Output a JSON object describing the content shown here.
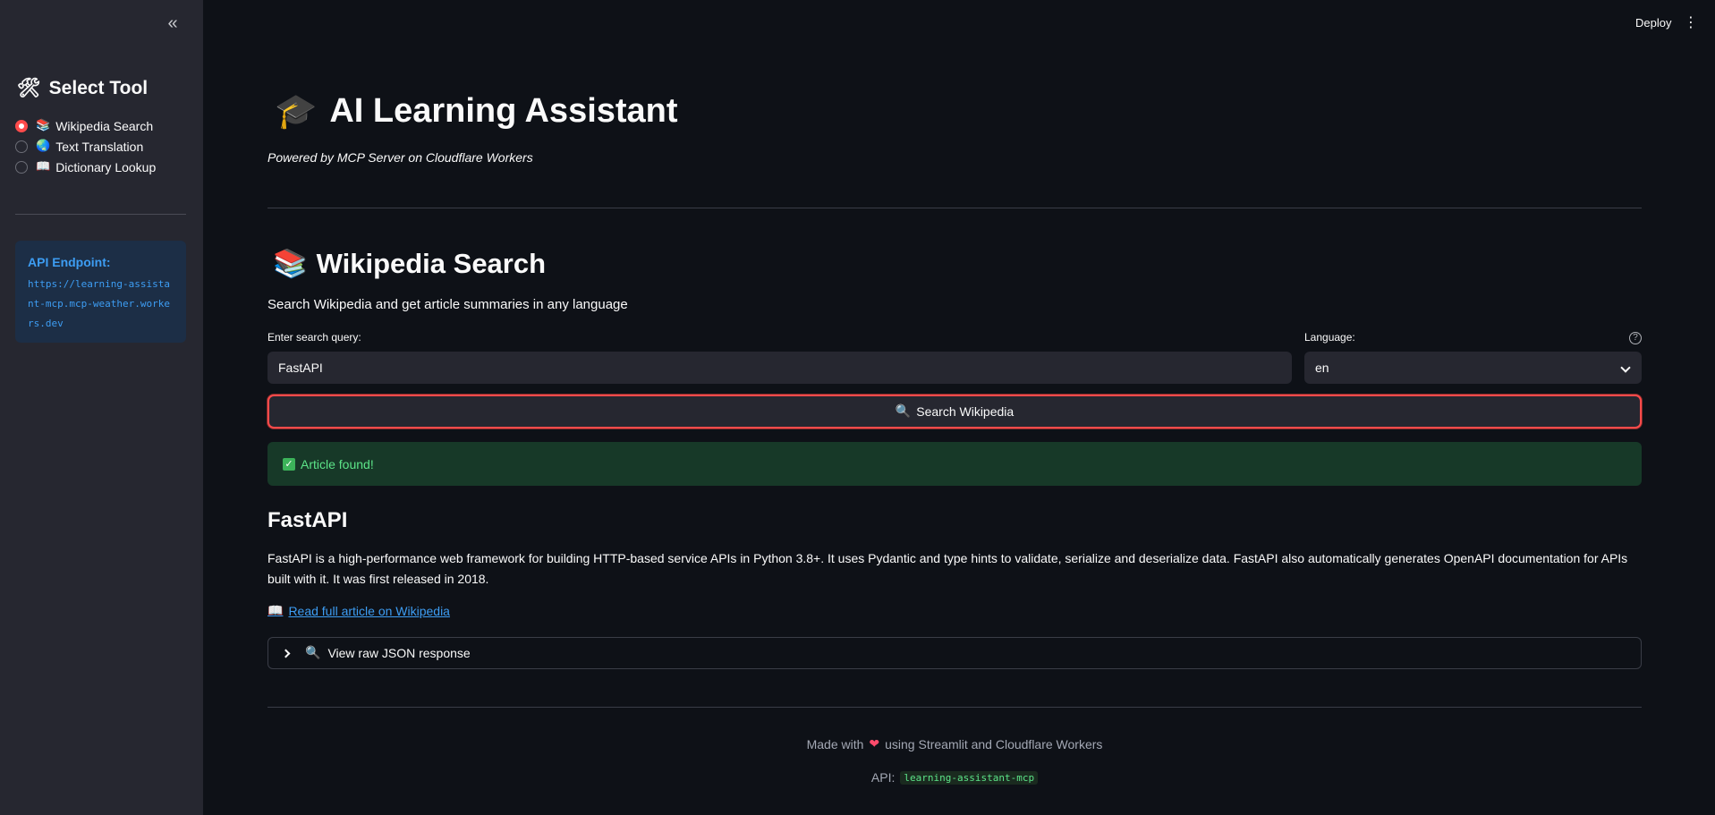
{
  "sidebar": {
    "collapse_icon": "«",
    "title_icon": "🛠",
    "title": "Select Tool",
    "tools": [
      {
        "icon": "📚",
        "label": "Wikipedia Search",
        "selected": true
      },
      {
        "icon": "🌏",
        "label": "Text Translation",
        "selected": false
      },
      {
        "icon": "📖",
        "label": "Dictionary Lookup",
        "selected": false
      }
    ],
    "api_label": "API Endpoint:",
    "api_url": "https://learning-assistant-mcp.mcp-weather.workers.dev"
  },
  "header": {
    "deploy_label": "Deploy",
    "menu_icon": "⋮"
  },
  "main": {
    "title_icon": "🎓",
    "title": "AI Learning Assistant",
    "subtitle": "Powered by MCP Server on Cloudflare Workers",
    "section_icon": "📚",
    "section_title": "Wikipedia Search",
    "section_desc": "Search Wikipedia and get article summaries in any language",
    "query_label": "Enter search query:",
    "query_value": "FastAPI",
    "language_label": "Language:",
    "language_value": "en",
    "help_icon": "?",
    "search_button_icon": "🔍",
    "search_button_label": "Search Wikipedia",
    "alert_icon": "✓",
    "alert_text": "Article found!",
    "article_title": "FastAPI",
    "article_summary": "FastAPI is a high-performance web framework for building HTTP-based service APIs in Python 3.8+. It uses Pydantic and type hints to validate, serialize and deserialize data. FastAPI also automatically generates OpenAPI documentation for APIs built with it. It was first released in 2018.",
    "link_icon": "📖",
    "link_text": "Read full article on Wikipedia",
    "expander_icon": "🔍",
    "expander_label": "View raw JSON response"
  },
  "footer": {
    "made_with_prefix": "Made with",
    "heart_icon": "❤",
    "made_with_suffix": "using Streamlit and Cloudflare Workers",
    "api_label": "API:",
    "api_code": "learning-assistant-mcp"
  },
  "colors": {
    "background": "#0e1117",
    "sidebar": "#262730",
    "accent": "#ff4b4b",
    "link": "#3d9df3",
    "success_bg": "#173928",
    "success_text": "#5ce488"
  }
}
